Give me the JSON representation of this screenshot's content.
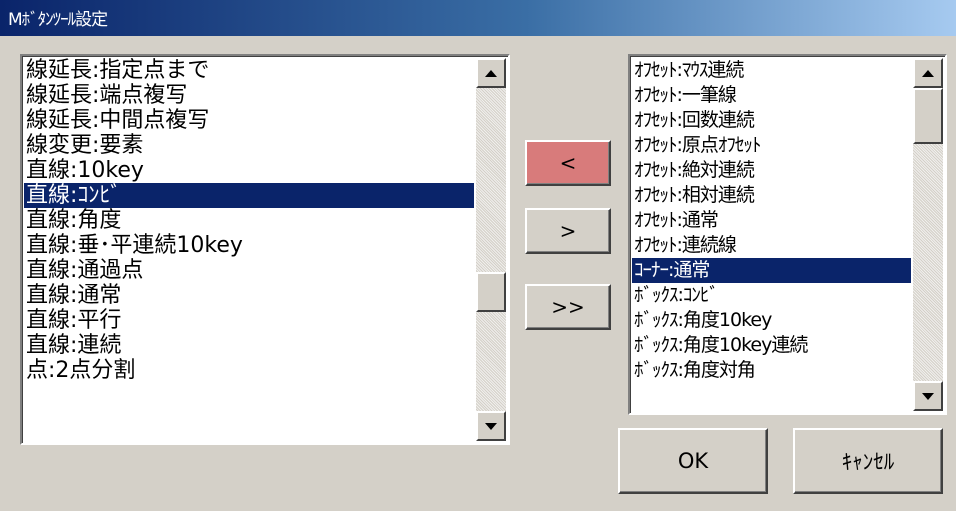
{
  "window": {
    "title": "Mﾎﾞﾀﾝﾂｰﾙ設定"
  },
  "left_list": {
    "items": [
      "線延長:指定点まで",
      "線延長:端点複写",
      "線延長:中間点複写",
      "線変更:要素",
      "直線:10key",
      "直線:ｺﾝﾋﾞ",
      "直線:角度",
      "直線:垂･平連続10key",
      "直線:通過点",
      "直線:通常",
      "直線:平行",
      "直線:連続",
      "点:2点分割"
    ],
    "selected_index": 5
  },
  "right_list": {
    "items": [
      "ｵﾌｾｯﾄ:ﾏｳｽ連続",
      "ｵﾌｾｯﾄ:一筆線",
      "ｵﾌｾｯﾄ:回数連続",
      "ｵﾌｾｯﾄ:原点ｵﾌｾｯﾄ",
      "ｵﾌｾｯﾄ:絶対連続",
      "ｵﾌｾｯﾄ:相対連続",
      "ｵﾌｾｯﾄ:通常",
      "ｵﾌｾｯﾄ:連続線",
      "ｺｰﾅｰ:通常",
      "ﾎﾞｯｸｽ:ｺﾝﾋﾞ",
      "ﾎﾞｯｸｽ:角度10key",
      "ﾎﾞｯｸｽ:角度10key連続",
      "ﾎﾞｯｸｽ:角度対角"
    ],
    "selected_index": 8
  },
  "buttons": {
    "move_left": "<",
    "move_right": ">",
    "move_all_right": ">>",
    "ok": "OK",
    "cancel": "ｷｬﾝｾﾙ"
  },
  "colors": {
    "selection": "#0a246a",
    "highlight_button": "#d87b7b",
    "face": "#d4d0c8"
  }
}
